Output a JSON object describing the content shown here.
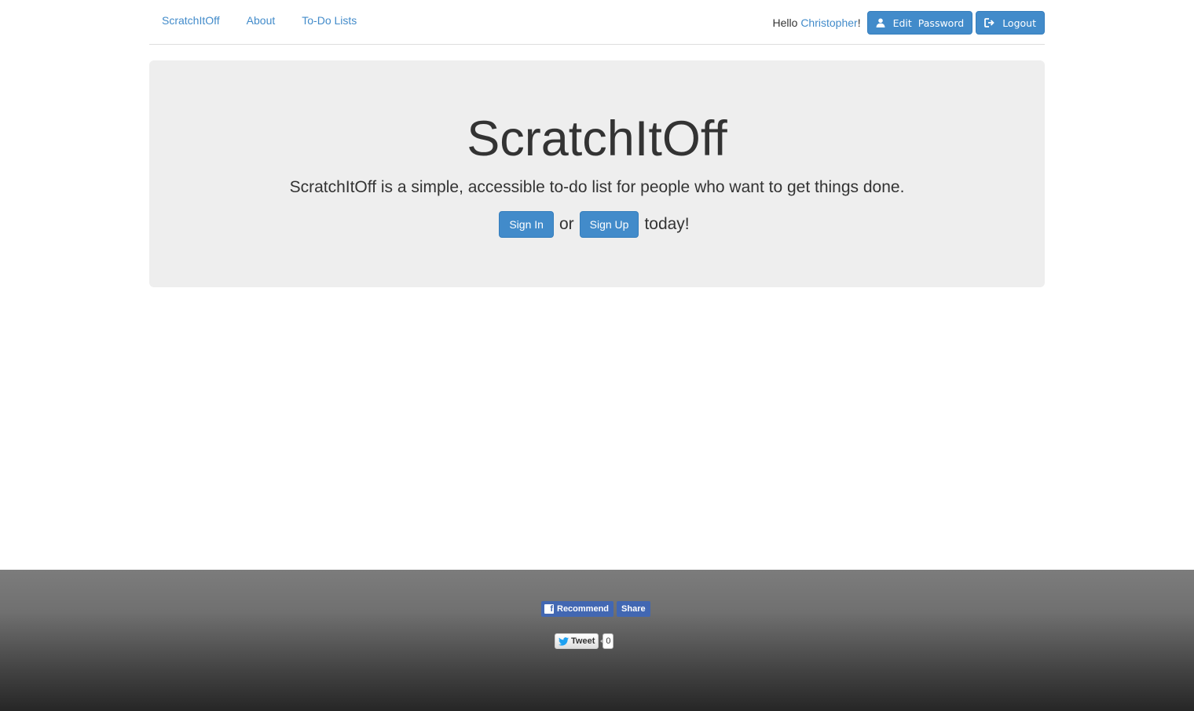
{
  "nav": {
    "links": [
      "ScratchItOff",
      "About",
      "To-Do Lists"
    ],
    "greeting_prefix": "Hello ",
    "user_name": "Christopher",
    "greeting_suffix": "!",
    "edit_password_word1": "Edit",
    "edit_password_word2": "Password",
    "logout_label": "Logout"
  },
  "hero": {
    "title": "ScratchItOff",
    "lead": "ScratchItOff is a simple, accessible to-do list for people who want to get things done.",
    "sign_in_label": "Sign In",
    "or_text": "or",
    "sign_up_label": "Sign Up",
    "today_text": "today!"
  },
  "footer": {
    "recommend_label": "Recommend",
    "share_label": "Share",
    "tweet_label": "Tweet",
    "tweet_count": "0"
  },
  "icons": {
    "edit_password": "user-icon",
    "logout": "logout-icon",
    "facebook": "facebook-icon",
    "twitter": "twitter-bird-icon"
  },
  "colors": {
    "primary": "#428bca",
    "jumbotron_bg": "#eeeeee",
    "facebook_blue": "#4267b2"
  }
}
